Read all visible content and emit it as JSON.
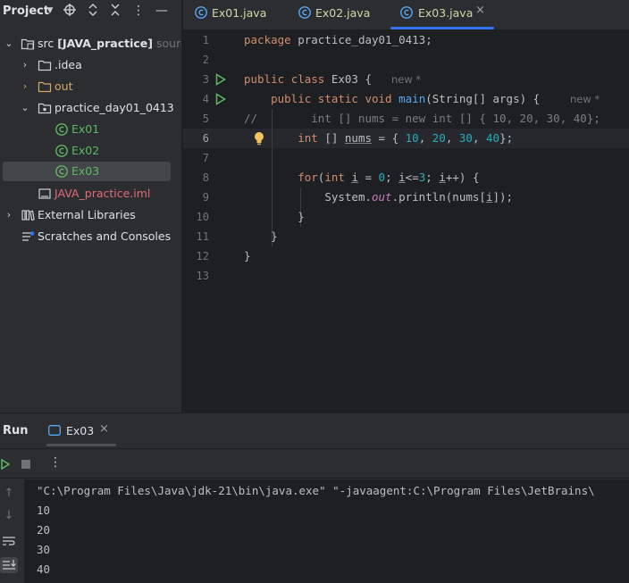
{
  "project_panel": {
    "title": "Project",
    "tree": [
      {
        "label": "src",
        "bold_suffix": "[JAVA_practice]",
        "muted_suffix": "sourc",
        "color": "#dfe1e5"
      },
      {
        "label": ".idea",
        "color": "#dfe1e5"
      },
      {
        "label": "out",
        "color": "#d5a964"
      },
      {
        "label": "practice_day01_0413",
        "color": "#dfe1e5"
      },
      {
        "label": "Ex01",
        "color": "#5fb865"
      },
      {
        "label": "Ex02",
        "color": "#5fb865"
      },
      {
        "label": "Ex03",
        "color": "#5fb865"
      },
      {
        "label": "JAVA_practice.iml",
        "color": "#e06c75"
      },
      {
        "label": "External Libraries",
        "color": "#dfe1e5"
      },
      {
        "label": "Scratches and Consoles",
        "color": "#dfe1e5"
      }
    ]
  },
  "tabs": [
    {
      "label": "Ex01.java"
    },
    {
      "label": "Ex02.java"
    },
    {
      "label": "Ex03.java",
      "active": true,
      "close": "×"
    }
  ],
  "editor": {
    "line_numbers": [
      "1",
      "2",
      "3",
      "4",
      "5",
      "6",
      "7",
      "8",
      "9",
      "10",
      "11",
      "12",
      "13"
    ],
    "current_line": "6",
    "hints": {
      "class_hint": "new *",
      "method_hint": "new *"
    },
    "lines": {
      "l1": {
        "kw": "package",
        "rest": " practice_day01_0413;"
      },
      "l3": {
        "kw1": "public",
        "kw2": "class",
        "rest": " Ex03 {"
      },
      "l4": {
        "kw1": "public",
        "kw2": "static",
        "kw3": "void",
        "fn": "main",
        "rest": "(String[] args) {"
      },
      "l5": {
        "comment": "//        int [] nums = new int [] { 10, 20, 30, 40};"
      },
      "l6": {
        "kw": "int",
        "p1": " [] ",
        "var": "nums",
        "p2": " = { ",
        "n1": "10",
        "c1": ", ",
        "n2": "20",
        "c2": ", ",
        "n3": "30",
        "c3": ", ",
        "n4": "40",
        "end": "};"
      },
      "l8": {
        "kw": "for",
        "p1": "(",
        "kw2": "int",
        "p2": " ",
        "v1": "i",
        "p3": " = ",
        "n1": "0",
        "p4": "; ",
        "v2": "i",
        "p5": "<=",
        "n2": "3",
        "p6": "; ",
        "v3": "i",
        "p7": "++) {"
      },
      "l9": {
        "p1": "System.",
        "field": "out",
        "p2": ".println(nums[",
        "v": "i",
        "p3": "]);"
      },
      "l10": {
        "text": "}"
      },
      "l11": {
        "text": "}"
      },
      "l12": {
        "text": "}"
      }
    }
  },
  "run_panel": {
    "title": "Run",
    "tab_label": "Ex03",
    "tab_close": "×",
    "console_lines": [
      "\"C:\\Program Files\\Java\\jdk-21\\bin\\java.exe\" \"-javaagent:C:\\Program Files\\JetBrains\\",
      "10",
      "20",
      "30",
      "40"
    ]
  },
  "icons": {
    "gutter_run": "run-triangle-icon",
    "gutter_bulb": "lightbulb-icon",
    "java_class": "java-class-icon"
  },
  "colors": {
    "accent": "#3574f0",
    "java_class_green": "#5fb865",
    "folder_orange": "#d5a964",
    "run_green": "#5fb865",
    "bulb_yellow": "#f2c55c"
  }
}
